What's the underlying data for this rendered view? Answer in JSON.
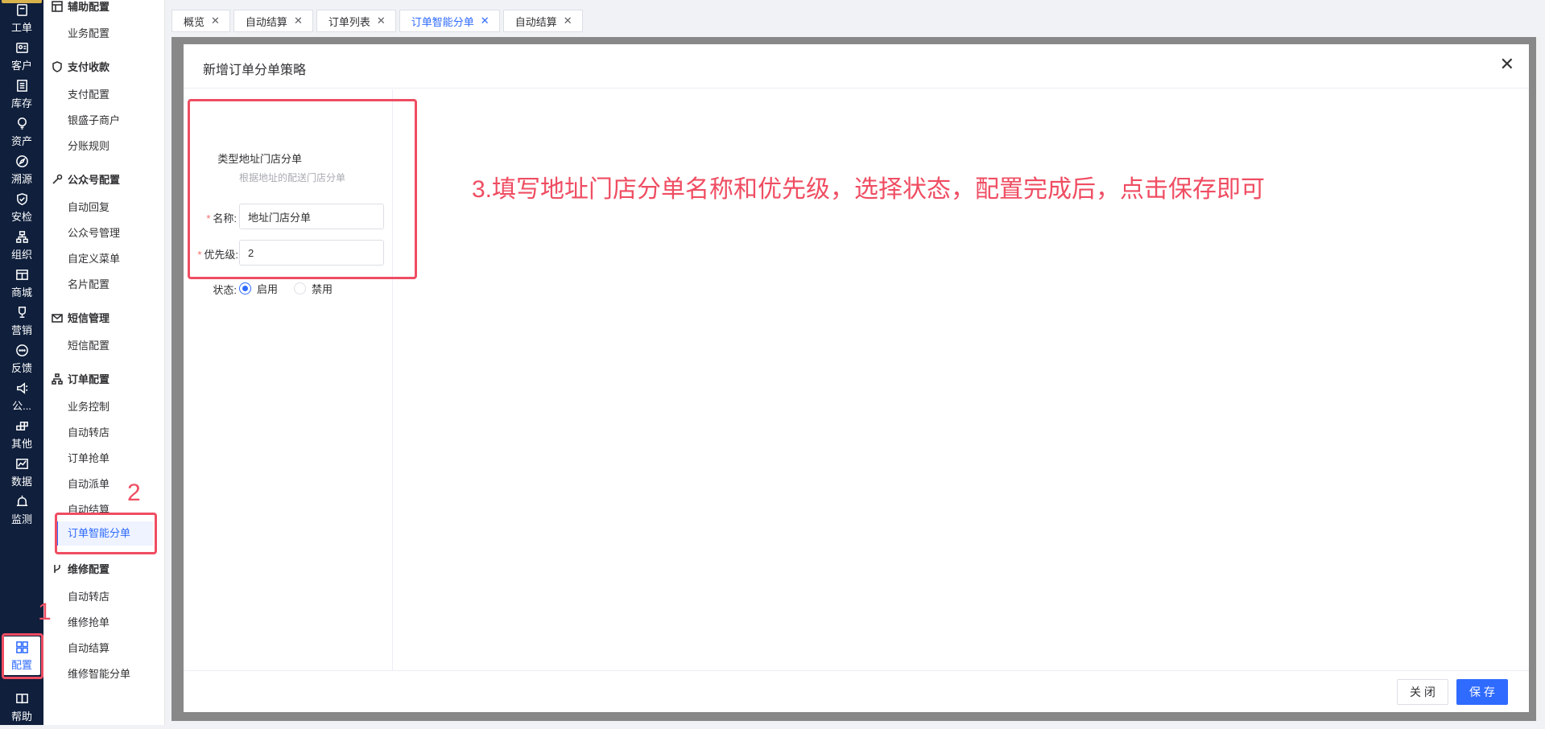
{
  "rail": {
    "items": [
      {
        "label": "工单",
        "icon": "ticket-icon"
      },
      {
        "label": "客户",
        "icon": "customer-icon"
      },
      {
        "label": "库存",
        "icon": "inventory-icon"
      },
      {
        "label": "资产",
        "icon": "asset-icon"
      },
      {
        "label": "溯源",
        "icon": "trace-icon"
      },
      {
        "label": "安检",
        "icon": "shield-icon"
      },
      {
        "label": "组织",
        "icon": "org-icon"
      },
      {
        "label": "商城",
        "icon": "shop-icon"
      },
      {
        "label": "营销",
        "icon": "trophy-icon"
      },
      {
        "label": "反馈",
        "icon": "chat-icon"
      },
      {
        "label": "公...",
        "icon": "megaphone-icon"
      },
      {
        "label": "其他",
        "icon": "blocks-icon"
      },
      {
        "label": "数据",
        "icon": "chart-icon"
      },
      {
        "label": "监测",
        "icon": "alarm-icon"
      },
      {
        "label": "配置",
        "icon": "grid-icon"
      },
      {
        "label": "帮助",
        "icon": "book-icon"
      }
    ]
  },
  "submenu": {
    "groups": [
      {
        "title": "辅助配置",
        "items": [
          "业务配置"
        ]
      },
      {
        "title": "支付收款",
        "items": [
          "支付配置",
          "银盛子商户",
          "分账规则"
        ]
      },
      {
        "title": "公众号配置",
        "items": [
          "自动回复",
          "公众号管理",
          "自定义菜单",
          "名片配置"
        ]
      },
      {
        "title": "短信管理",
        "items": [
          "短信配置"
        ]
      },
      {
        "title": "订单配置",
        "items": [
          "业务控制",
          "自动转店",
          "订单抢单",
          "自动派单",
          "自动结算",
          "订单智能分单"
        ]
      },
      {
        "title": "维修配置",
        "items": [
          "自动转店",
          "维修抢单",
          "自动结算",
          "维修智能分单"
        ]
      }
    ]
  },
  "tabs": [
    "概览",
    "自动结算",
    "订单列表",
    "订单智能分单",
    "自动结算"
  ],
  "modal": {
    "title": "新增订单分单策略",
    "type_label": "类型:",
    "type_value": "地址门店分单",
    "type_hint": "根据地址的配送门店分单",
    "name_label": "名称:",
    "name_value": "地址门店分单",
    "priority_label": "优先级:",
    "priority_value": "2",
    "status_label": "状态:",
    "status_on": "启用",
    "status_off": "禁用",
    "status_selected": "启用",
    "close_btn": "关 闭",
    "save_btn": "保 存"
  },
  "annotations": {
    "step1": "1",
    "step2": "2",
    "step3": "3.填写地址门店分单名称和优先级，选择状态，配置完成后，点击保存即可",
    "color": "#ef4d62"
  },
  "colors": {
    "primary": "#2f6bff",
    "rail_bg": "#0f1f3c",
    "required": "#f56c6c"
  }
}
